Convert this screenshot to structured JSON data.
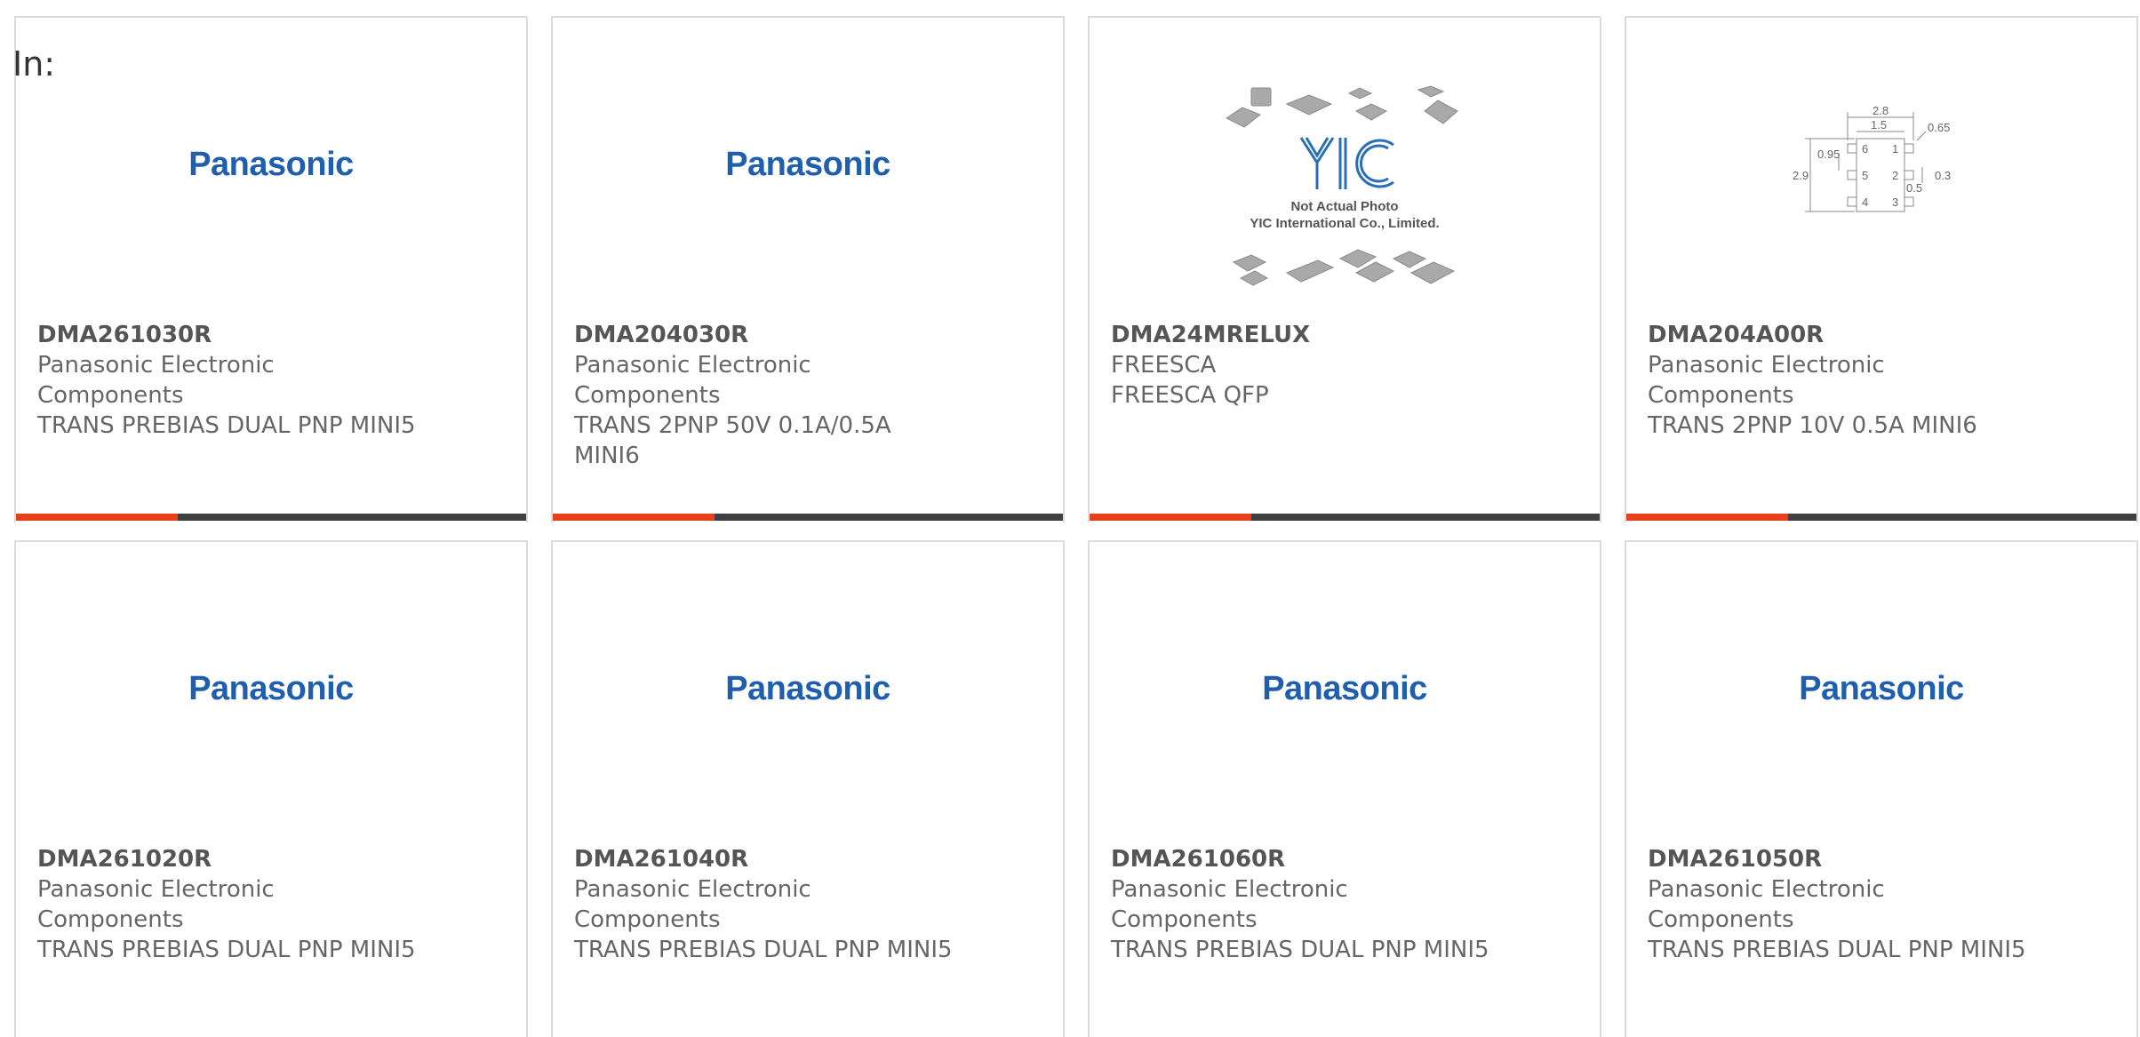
{
  "filter": {
    "label": "In:"
  },
  "products": [
    {
      "part_number": "DMA261030R",
      "manufacturer": "Panasonic Electronic Components",
      "description": "TRANS PREBIAS DUAL PNP MINI5",
      "image": "Panasonic"
    },
    {
      "part_number": "DMA204030R",
      "manufacturer": "Panasonic Electronic Components",
      "description": "TRANS 2PNP 50V 0.1A/0.5A MINI6",
      "image": "Panasonic"
    },
    {
      "part_number": "DMA24MRELUX",
      "manufacturer": "FREESCA",
      "description": "FREESCA QFP",
      "image_text_1": "Not Actual Photo",
      "image_text_2": "YIC International Co., Limited."
    },
    {
      "part_number": "DMA204A00R",
      "manufacturer": "Panasonic Electronic Components",
      "description": "TRANS 2PNP 10V 0.5A MINI6",
      "dims": {
        "a": "2.8",
        "b": "1.5",
        "c": "0.65",
        "d": "0.95",
        "e": "2.9",
        "f": "0.3",
        "g": "0.5",
        "pins": [
          "6",
          "1",
          "5",
          "2",
          "4",
          "3"
        ]
      }
    },
    {
      "part_number": "DMA261020R",
      "manufacturer": "Panasonic Electronic Components",
      "description": "TRANS PREBIAS DUAL PNP MINI5",
      "image": "Panasonic"
    },
    {
      "part_number": "DMA261040R",
      "manufacturer": "Panasonic Electronic Components",
      "description": "TRANS PREBIAS DUAL PNP MINI5",
      "image": "Panasonic"
    },
    {
      "part_number": "DMA261060R",
      "manufacturer": "Panasonic Electronic Components",
      "description": "TRANS PREBIAS DUAL PNP MINI5",
      "image": "Panasonic"
    },
    {
      "part_number": "DMA261050R",
      "manufacturer": "Panasonic Electronic Components",
      "description": "TRANS PREBIAS DUAL PNP MINI5",
      "image": "Panasonic"
    }
  ],
  "colors": {
    "accent": "#e8401a",
    "bar": "#404040",
    "panasonic_blue": "#1f5fae",
    "yic_blue": "#2a6fb5"
  }
}
